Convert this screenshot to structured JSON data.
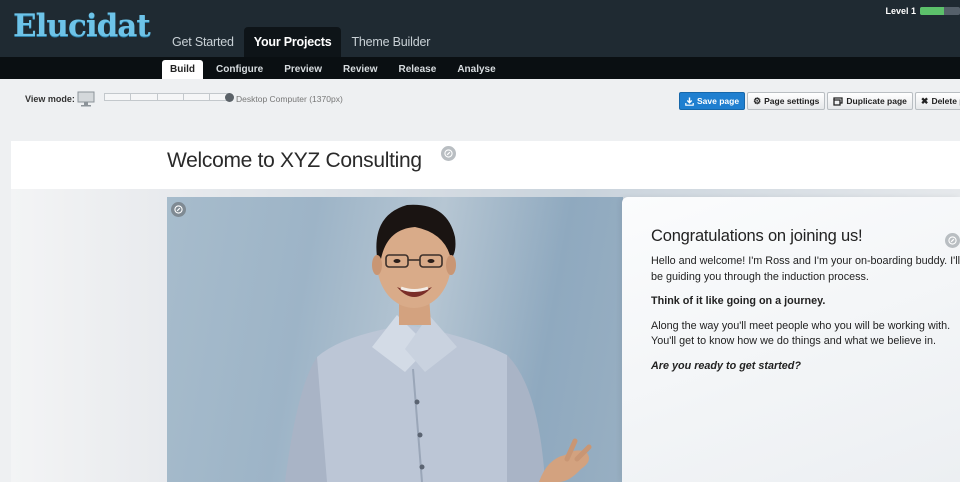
{
  "app": {
    "logo": "Elucidat"
  },
  "header": {
    "tabs": [
      {
        "label": "Get Started",
        "active": false
      },
      {
        "label": "Your Projects",
        "active": true
      },
      {
        "label": "Theme Builder",
        "active": false
      }
    ],
    "level": {
      "label": "Level 1",
      "progress": 0.6,
      "color": "#5cc16b"
    }
  },
  "subnav": {
    "tabs": [
      {
        "label": "Build",
        "active": true
      },
      {
        "label": "Configure",
        "active": false
      },
      {
        "label": "Preview",
        "active": false
      },
      {
        "label": "Review",
        "active": false
      },
      {
        "label": "Release",
        "active": false
      },
      {
        "label": "Analyse",
        "active": false
      }
    ]
  },
  "toolbar": {
    "view_mode_label": "View mode:",
    "view_mode_value": "Desktop Computer (1370px)",
    "buttons": {
      "save": "Save page",
      "settings": "Page settings",
      "duplicate": "Duplicate page",
      "delete": "Delete page"
    },
    "accent": "#1f7fd0"
  },
  "page": {
    "title": "Welcome to XYZ Consulting",
    "card": {
      "heading": "Congratulations on joining us!",
      "para1": "Hello and welcome! I'm Ross and I'm your on-boarding buddy. I'll be guiding you through the induction process.",
      "para2": "Think of it like going on a journey.",
      "para3": "Along the way you'll meet people who you will be working with. You'll get to know how we do things and what we believe in.",
      "para4": "Are you ready to get started?"
    }
  }
}
